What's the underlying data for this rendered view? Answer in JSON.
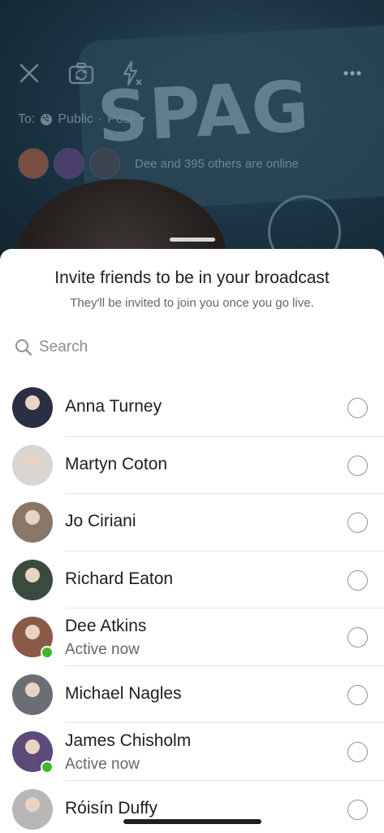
{
  "camera": {
    "sign_text": "SPAG",
    "audience": {
      "to_label": "To:",
      "privacy": "Public",
      "separator": "·",
      "destination": "Post"
    },
    "online_text": "Dee and 395 others are online"
  },
  "sheet": {
    "title": "Invite friends to be in your broadcast",
    "subtitle": "They'll be invited to join you once you go live.",
    "search_placeholder": "Search"
  },
  "friends": [
    {
      "name": "Anna Turney",
      "status": "",
      "online": false,
      "avatar_color": "#2b2f44"
    },
    {
      "name": "Martyn Coton",
      "status": "",
      "online": false,
      "avatar_color": "#d9d6d2"
    },
    {
      "name": "Jo Ciriani",
      "status": "",
      "online": false,
      "avatar_color": "#8a7768"
    },
    {
      "name": "Richard Eaton",
      "status": "",
      "online": false,
      "avatar_color": "#3a4a3e"
    },
    {
      "name": "Dee Atkins",
      "status": "Active now",
      "online": true,
      "avatar_color": "#8a5a48"
    },
    {
      "name": "Michael Nagles",
      "status": "",
      "online": false,
      "avatar_color": "#6b6e74"
    },
    {
      "name": "James Chisholm",
      "status": "Active now",
      "online": true,
      "avatar_color": "#5b4a7a"
    },
    {
      "name": "Róisín Duffy",
      "status": "",
      "online": false,
      "avatar_color": "#b9b7b5"
    }
  ],
  "colors": {
    "online_green": "#42b72a",
    "sheet_bg": "#ffffff",
    "camera_bg": "#1d3443"
  }
}
